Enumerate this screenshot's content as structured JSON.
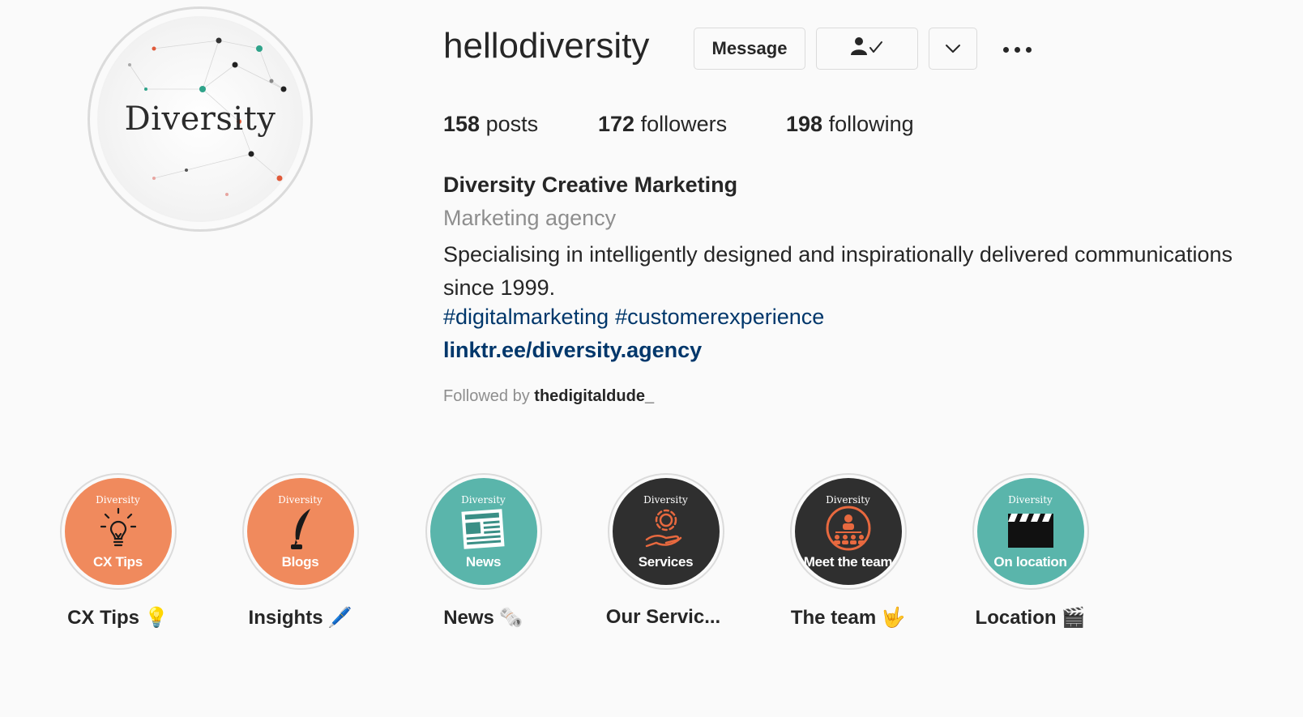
{
  "profile": {
    "username": "hellodiversity",
    "avatar_text": "Diversity",
    "actions": {
      "message_label": "Message",
      "following_icon": "person-check-icon",
      "dropdown_icon": "chevron-down-icon",
      "more_icon": "ellipsis-icon"
    },
    "stats": {
      "posts_count": "158",
      "posts_label": " posts",
      "followers_count": "172",
      "followers_label": " followers",
      "following_count": "198",
      "following_label": " following"
    },
    "full_name": "Diversity Creative Marketing",
    "category": "Marketing agency",
    "bio": "Specialising in intelligently designed and inspirationally delivered communications since 1999.",
    "hashtags": [
      "#digitalmarketing",
      "#customerexperience"
    ],
    "link": "linktr.ee/diversity.agency",
    "followed_by_prefix": "Followed by ",
    "followed_by_user": "thedigitaldude_"
  },
  "highlights": [
    {
      "label": "CX Tips",
      "emoji": "💡",
      "brand": "Diversity",
      "caption": "CX Tips",
      "color": "#f08a5d",
      "icon": "lightbulb-icon"
    },
    {
      "label": "Insights",
      "emoji": "🖊️",
      "brand": "Diversity",
      "caption": "Blogs",
      "color": "#f08a5d",
      "icon": "quill-pen-icon"
    },
    {
      "label": "News",
      "emoji": "🗞️",
      "brand": "Diversity",
      "caption": "News",
      "color": "#5ab5ab",
      "icon": "newspaper-icon"
    },
    {
      "label": "Our Servic...",
      "emoji": "",
      "brand": "Diversity",
      "caption": "Services",
      "color": "#2f2f2f",
      "icon": "gear-hand-icon"
    },
    {
      "label": "The team",
      "emoji": "🤟",
      "brand": "Diversity",
      "caption": "Meet the team",
      "color": "#2f2f2f",
      "icon": "team-icon"
    },
    {
      "label": "Location",
      "emoji": "🎬",
      "brand": "Diversity",
      "caption": "On location",
      "color": "#5ab5ab",
      "icon": "clapperboard-icon"
    }
  ],
  "colors": {
    "link_blue": "#00376b",
    "muted_gray": "#8e8e8e",
    "border": "#dbdbdb",
    "orange": "#f08a5d",
    "teal": "#5ab5ab",
    "dark": "#2f2f2f"
  }
}
